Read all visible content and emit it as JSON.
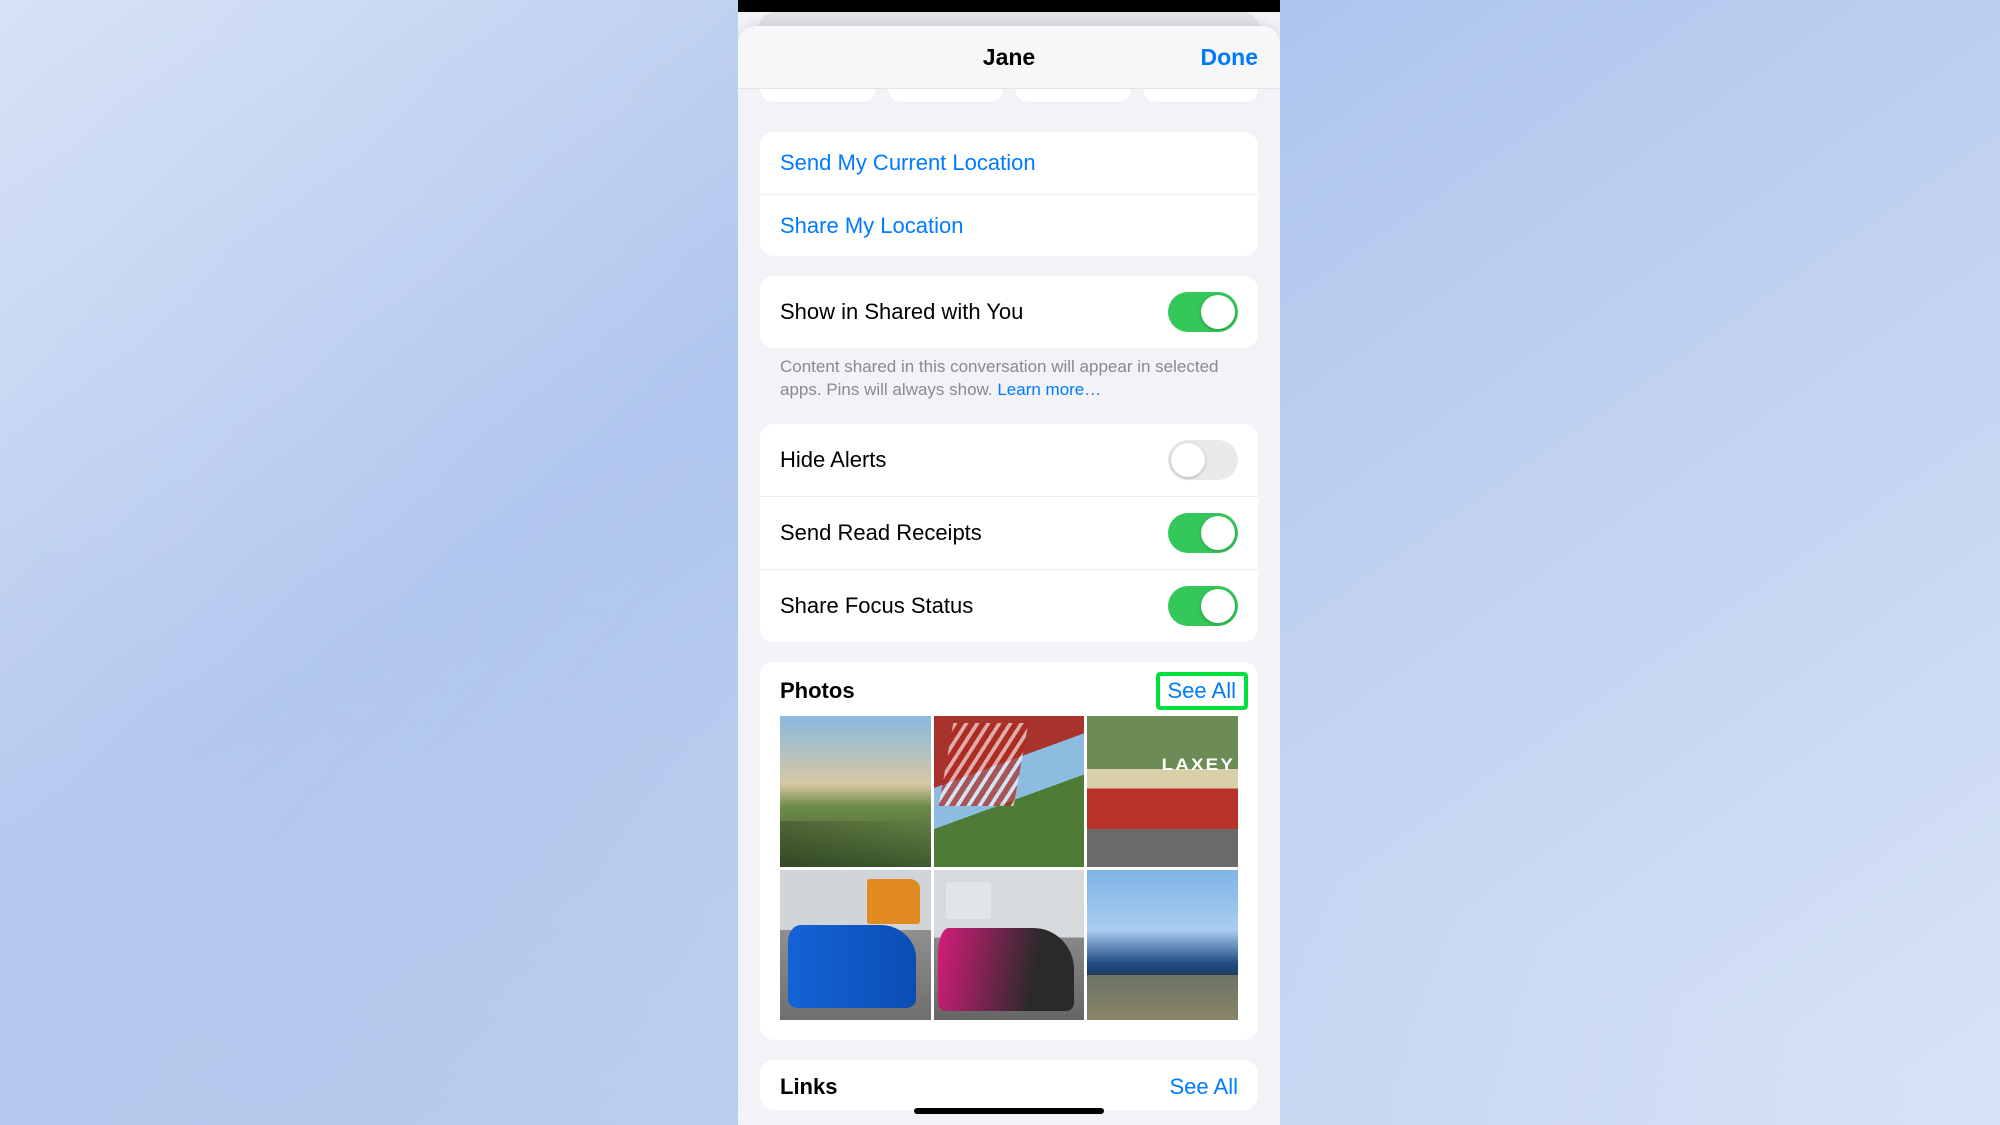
{
  "header": {
    "title": "Jane",
    "done": "Done"
  },
  "location_actions": {
    "send_current": "Send My Current Location",
    "share": "Share My Location"
  },
  "shared_with_you": {
    "label": "Show in Shared with You",
    "footer_text": "Content shared in this conversation will appear in selected apps. Pins will always show. ",
    "learn_more": "Learn more…"
  },
  "toggles": {
    "hide_alerts": {
      "label": "Hide Alerts",
      "on": false
    },
    "send_read_receipts": {
      "label": "Send Read Receipts",
      "on": true
    },
    "share_focus_status": {
      "label": "Share Focus Status",
      "on": true
    },
    "shared_with_you_on": true
  },
  "photos": {
    "title": "Photos",
    "see_all": "See All"
  },
  "links": {
    "title": "Links",
    "see_all": "See All"
  },
  "colors": {
    "accent": "#007aff",
    "toggle_on": "#34c759",
    "highlight": "#00e03c"
  }
}
